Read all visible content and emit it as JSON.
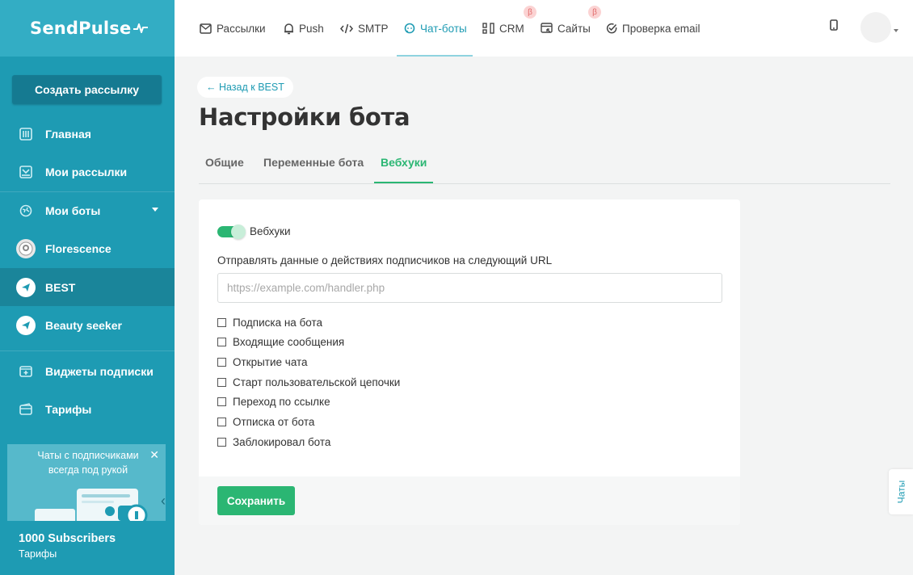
{
  "brand": {
    "logo_text": "SendPulse"
  },
  "sidebar": {
    "create_button": "Создать рассылку",
    "items": [
      {
        "label": "Главная",
        "icon": "dashboard-icon"
      },
      {
        "label": "Мои рассылки",
        "icon": "mailings-icon"
      },
      {
        "label": "Мои боты",
        "icon": "globe-icon"
      }
    ],
    "bots": [
      {
        "label": "Florescence",
        "icon": "bot-avatar-icon"
      },
      {
        "label": "BEST",
        "icon": "telegram-icon",
        "active": true
      },
      {
        "label": "Beauty seeker",
        "icon": "telegram-icon"
      }
    ],
    "bottom_items": [
      {
        "label": "Виджеты подписки",
        "icon": "widget-icon"
      },
      {
        "label": "Тарифы",
        "icon": "wallet-icon"
      }
    ],
    "promo": {
      "text": "Чаты с подписчиками всегда под рукой"
    },
    "plan": {
      "title": "1000 Subscribers",
      "subtitle": "Тарифы"
    }
  },
  "topnav": [
    {
      "label": "Рассылки",
      "icon": "mail-icon"
    },
    {
      "label": "Push",
      "icon": "bell-icon"
    },
    {
      "label": "SMTP",
      "icon": "code-icon"
    },
    {
      "label": "Чат-боты",
      "icon": "chat-icon",
      "active": true
    },
    {
      "label": "CRM",
      "icon": "crm-icon",
      "beta": "β"
    },
    {
      "label": "Сайты",
      "icon": "site-icon",
      "beta": "β"
    },
    {
      "label": "Проверка email",
      "icon": "check-circle-icon"
    }
  ],
  "main": {
    "back_link": "← Назад к BEST",
    "title": "Настройки бота",
    "tabs": [
      {
        "label": "Общие"
      },
      {
        "label": "Переменные бота"
      },
      {
        "label": "Вебхуки",
        "active": true
      }
    ],
    "webhooks": {
      "toggle_label": "Вебхуки",
      "toggle_on": true,
      "url_label": "Отправлять данные о действиях подписчиков на следующий URL",
      "url_placeholder": "https://example.com/handler.php",
      "url_value": "",
      "events": [
        {
          "label": "Подписка на бота",
          "checked": false
        },
        {
          "label": "Входящие сообщения",
          "checked": false
        },
        {
          "label": "Открытие чата",
          "checked": false
        },
        {
          "label": "Старт пользовательской цепочки",
          "checked": false
        },
        {
          "label": "Переход по ссылке",
          "checked": false
        },
        {
          "label": "Отписка от бота",
          "checked": false
        },
        {
          "label": "Заблокировал бота",
          "checked": false
        }
      ],
      "save_button": "Сохранить"
    }
  },
  "chats_tab": "Чаты",
  "colors": {
    "sidebar": "#1e9bb3",
    "accent_green": "#2bb673",
    "accent_teal": "#1e9bb3"
  }
}
